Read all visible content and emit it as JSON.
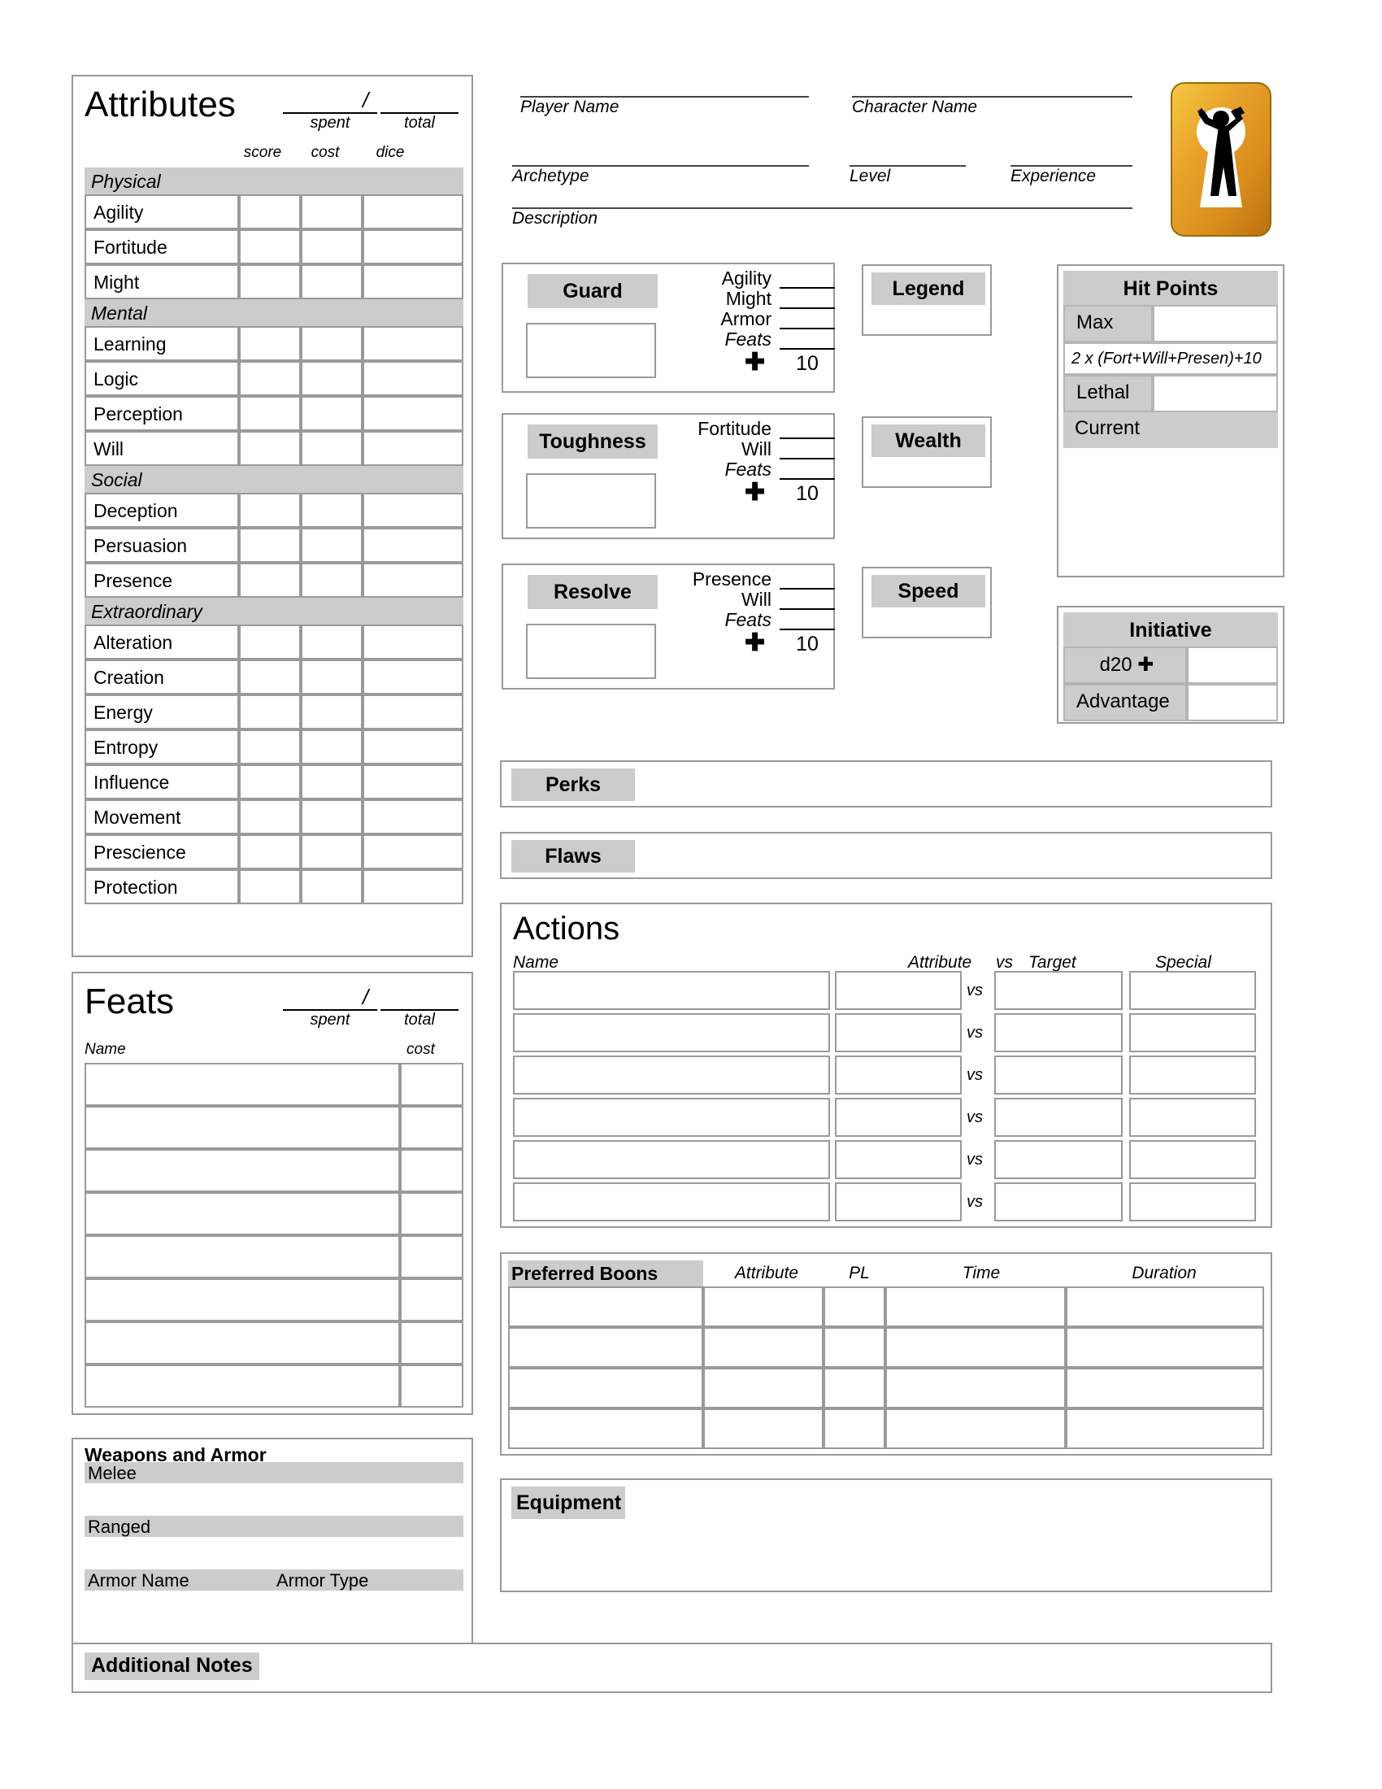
{
  "header": {
    "player_name_label": "Player Name",
    "character_name_label": "Character Name",
    "archetype_label": "Archetype",
    "level_label": "Level",
    "experience_label": "Experience",
    "description_label": "Description",
    "logo_name": "keyhole-wrench-logo"
  },
  "attributes": {
    "title": "Attributes",
    "spent_label": "spent",
    "total_label": "total",
    "slash": "/",
    "col_score": "score",
    "col_cost": "cost",
    "col_dice": "dice",
    "groups": [
      {
        "name": "Physical",
        "items": [
          "Agility",
          "Fortitude",
          "Might"
        ]
      },
      {
        "name": "Mental",
        "items": [
          "Learning",
          "Logic",
          "Perception",
          "Will"
        ]
      },
      {
        "name": "Social",
        "items": [
          "Deception",
          "Persuasion",
          "Presence"
        ]
      },
      {
        "name": "Extraordinary",
        "items": [
          "Alteration",
          "Creation",
          "Energy",
          "Entropy",
          "Influence",
          "Movement",
          "Prescience",
          "Protection"
        ]
      }
    ]
  },
  "feats": {
    "title": "Feats",
    "spent_label": "spent",
    "total_label": "total",
    "slash": "/",
    "col_name": "Name",
    "col_cost": "cost",
    "rows": [
      "",
      "",
      "",
      "",
      "",
      "",
      "",
      ""
    ]
  },
  "weapons": {
    "title": "Weapons and Armor",
    "melee_label": "Melee",
    "ranged_label": "Ranged",
    "armor_name_label": "Armor Name",
    "armor_type_label": "Armor Type"
  },
  "defenses": [
    {
      "name": "Guard",
      "modifiers": [
        {
          "label": "Agility",
          "italic": false
        },
        {
          "label": "Might",
          "italic": false
        },
        {
          "label": "Armor",
          "italic": false
        },
        {
          "label": "Feats",
          "italic": true
        }
      ],
      "plus": "✚",
      "base": "10"
    },
    {
      "name": "Toughness",
      "modifiers": [
        {
          "label": "Fortitude",
          "italic": false
        },
        {
          "label": "Will",
          "italic": false
        },
        {
          "label": "Feats",
          "italic": true
        }
      ],
      "plus": "✚",
      "base": "10"
    },
    {
      "name": "Resolve",
      "modifiers": [
        {
          "label": "Presence",
          "italic": false
        },
        {
          "label": "Will",
          "italic": false
        },
        {
          "label": "Feats",
          "italic": true
        }
      ],
      "plus": "✚",
      "base": "10"
    }
  ],
  "side_stats": [
    {
      "name": "Legend"
    },
    {
      "name": "Wealth"
    },
    {
      "name": "Speed"
    }
  ],
  "hit_points": {
    "title": "Hit Points",
    "max_label": "Max",
    "formula": "2 x (Fort+Will+Presen)+10",
    "lethal_label": "Lethal",
    "current_label": "Current"
  },
  "initiative": {
    "title": "Initiative",
    "d20_label": "d20 ✚",
    "advantage_label": "Advantage"
  },
  "perks": {
    "title": "Perks"
  },
  "flaws": {
    "title": "Flaws"
  },
  "actions": {
    "title": "Actions",
    "col_name": "Name",
    "col_attribute": "Attribute",
    "col_vs": "vs",
    "col_target": "Target",
    "col_special": "Special",
    "rows": [
      "",
      "",
      "",
      "",
      "",
      ""
    ]
  },
  "boons": {
    "title": "Preferred Boons",
    "col_attribute": "Attribute",
    "col_pl": "PL",
    "col_time": "Time",
    "col_duration": "Duration",
    "rows": [
      "",
      "",
      "",
      ""
    ]
  },
  "equipment": {
    "title": "Equipment"
  },
  "notes": {
    "title": "Additional Notes"
  }
}
